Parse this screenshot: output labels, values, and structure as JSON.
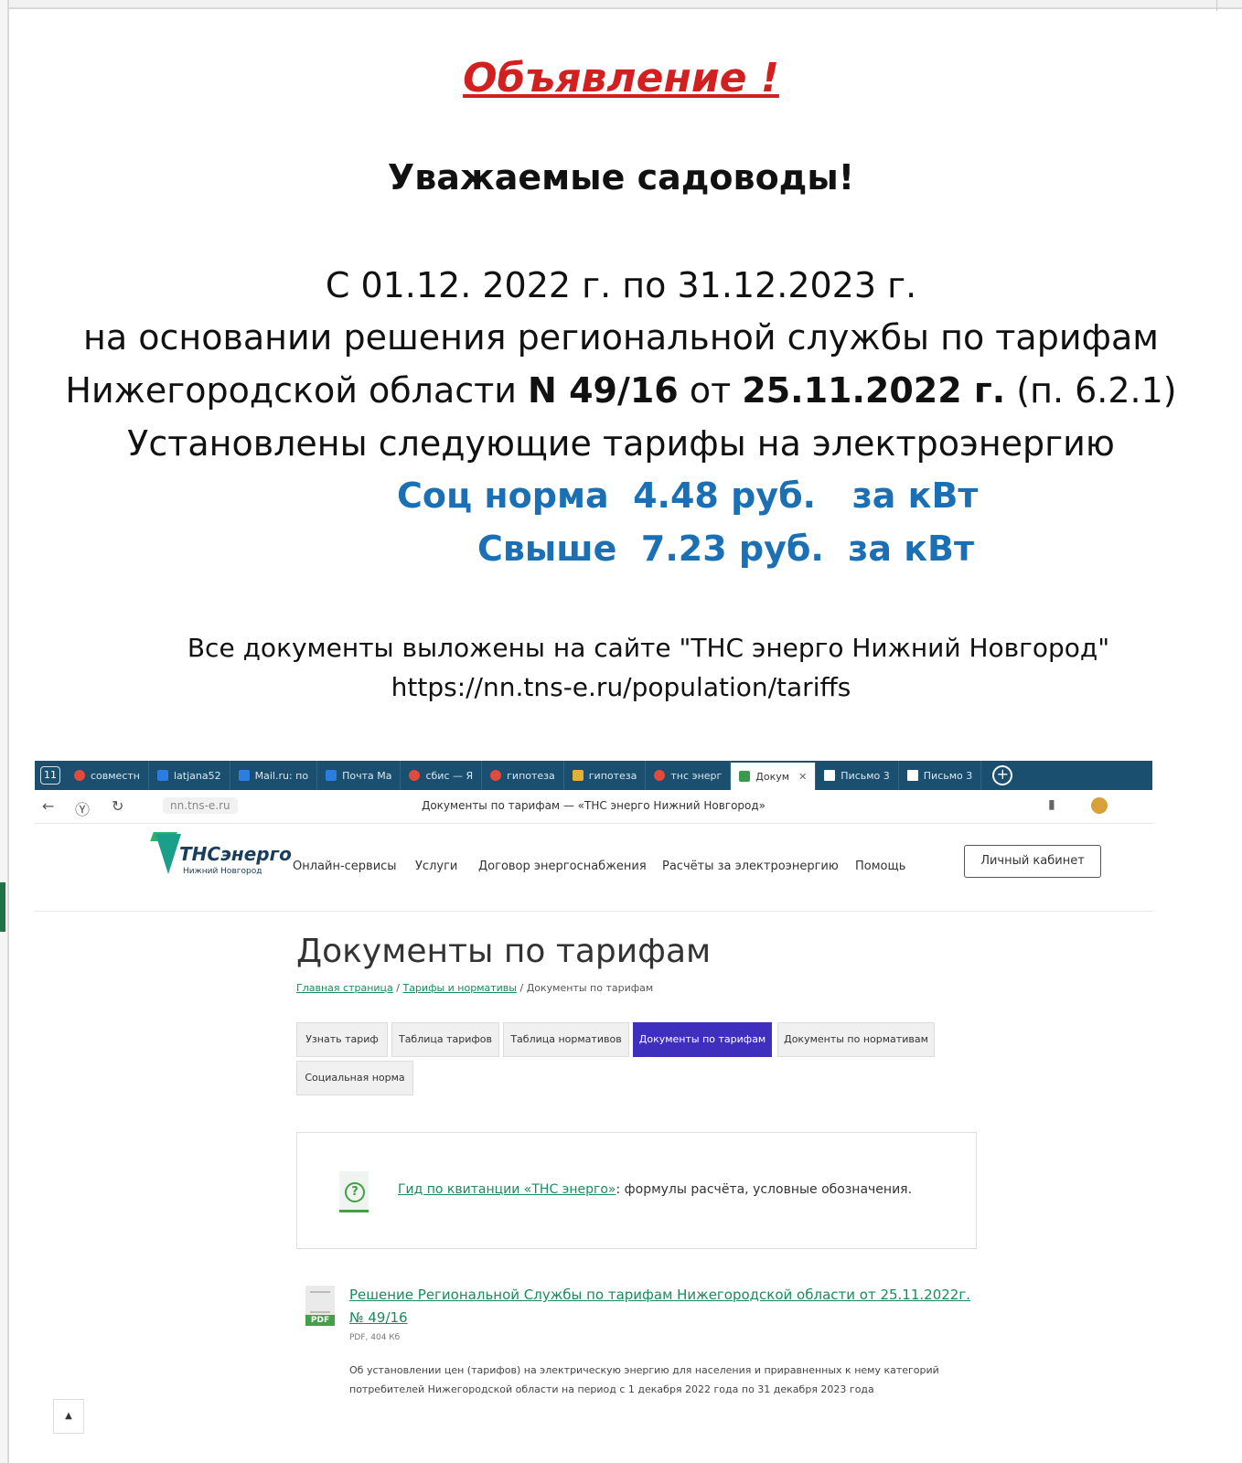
{
  "notice": {
    "title": "Объявление !",
    "greeting": "Уважаемые садоводы!",
    "line1": "С 01.12. 2022 г. по 31.12.2023 г.",
    "line2": "на основании решения региональной службы по тарифам",
    "line3_a": "Нижегородской области ",
    "line3_b": "N 49/16",
    "line3_c": " от ",
    "line3_d": "25.11.2022 г.",
    "line3_e": " (п. 6.2.1)",
    "line4": "Установлены следующие тарифы на электроэнергию",
    "tariff1": "Соц норма  4.48 руб.   за кВт",
    "tariff2": "Свыше  7.23 руб.  за кВт",
    "site_line": "Все документы выложены на сайте \"ТНС энерго Нижний Новгород\"",
    "site_url": "https://nn.tns-e.ru/population/tariffs"
  },
  "browser": {
    "tab_count": "11",
    "tabs": [
      "совместн",
      "latjana52",
      "Mail.ru: по",
      "Почта Ма",
      "сбис — Я",
      "гипотеза",
      "гипотеза",
      "тнс энерг",
      "Докум",
      "Письмо 3",
      "Письмо 3"
    ],
    "address": "nn.tns-e.ru",
    "page_title": "Документы по тарифам — «ТНС энерго Нижний Новгород»"
  },
  "site": {
    "logo_text": "ТНСэнерго",
    "logo_sub": "Нижний Новгород",
    "menu": [
      "Онлайн-сервисы",
      "Услуги",
      "Договор энергоснабжения",
      "Расчёты за электроэнергию",
      "Помощь"
    ],
    "cabinet": "Личный кабинет",
    "title": "Документы по тарифам",
    "crumb_home": "Главная страница",
    "crumb_sep": "/",
    "crumb_tariffs": "Тарифы и нормативы",
    "crumb_current": "Документы по тарифам",
    "pills": [
      "Узнать тариф",
      "Таблица тарифов",
      "Таблица нормативов",
      "Документы по тарифам",
      "Документы по нормативам",
      "Социальная норма"
    ],
    "guide_link": "Гид по квитанции «ТНС энерго»",
    "guide_rest": ": формулы расчёта, условные обозначения.",
    "doc_link": "Решение Региональной Службы по тарифам Нижегородской области от 25.11.2022г. № 49/16",
    "doc_meta": "PDF, 404 Кб",
    "doc_desc": "Об установлении цен (тарифов) на электрическую энергию для населения и приравненных к нему категорий потребителей Нижегородской области на период с 1 декабря 2022 года по 31 декабря 2023 года",
    "pdf_label": "PDF",
    "scroll_top": "▲"
  },
  "colors": {
    "title_red": "#d21f1f",
    "tariff_blue": "#1a6fb5",
    "active_pill": "#3f2fbf",
    "link_green": "#1c8a5c",
    "tabbar": "#1a4f6f"
  }
}
